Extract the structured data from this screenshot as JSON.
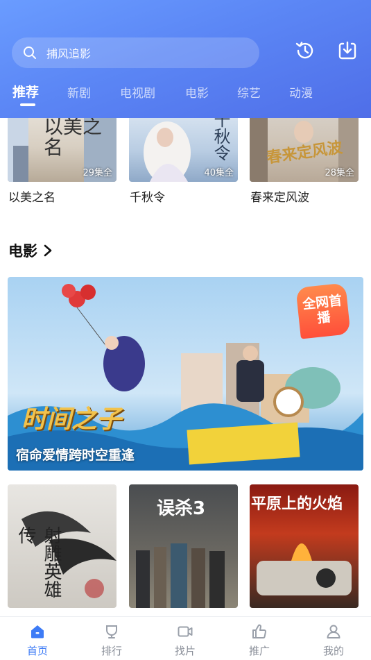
{
  "header": {
    "search_placeholder": "捕风追影",
    "history_icon": "history-icon",
    "download_icon": "download-icon"
  },
  "tabs": [
    {
      "label": "推荐",
      "active": true
    },
    {
      "label": "新剧"
    },
    {
      "label": "电视剧"
    },
    {
      "label": "电影"
    },
    {
      "label": "综艺"
    },
    {
      "label": "动漫"
    }
  ],
  "dramas": [
    {
      "title": "以美之名",
      "episodes": "29集全",
      "poster_text": "以美之名"
    },
    {
      "title": "千秋令",
      "episodes": "40集全",
      "poster_text": "千秋令"
    },
    {
      "title": "春来定风波",
      "episodes": "28集全",
      "poster_text": "春来定风波"
    }
  ],
  "movie_section": {
    "title": "电影",
    "banner_caption": "宿命爱情跨时空重逢",
    "banner_badge": "全网首播",
    "banner_logo": "时间之子"
  },
  "movies": [
    {
      "poster_text": "射雕英雄传"
    },
    {
      "poster_text": "误杀3"
    },
    {
      "poster_text": "平原上的火焰"
    }
  ],
  "bottom_nav": [
    {
      "label": "首页",
      "icon": "home-icon",
      "active": true
    },
    {
      "label": "排行",
      "icon": "ranking-icon"
    },
    {
      "label": "找片",
      "icon": "video-icon"
    },
    {
      "label": "推广",
      "icon": "thumbs-up-icon"
    },
    {
      "label": "我的",
      "icon": "user-icon"
    }
  ],
  "colors": {
    "header_start": "#6a9cff",
    "header_end": "#4f6ee8",
    "nav_active": "#3d7bf6",
    "nav_inactive": "#8a8f99"
  }
}
